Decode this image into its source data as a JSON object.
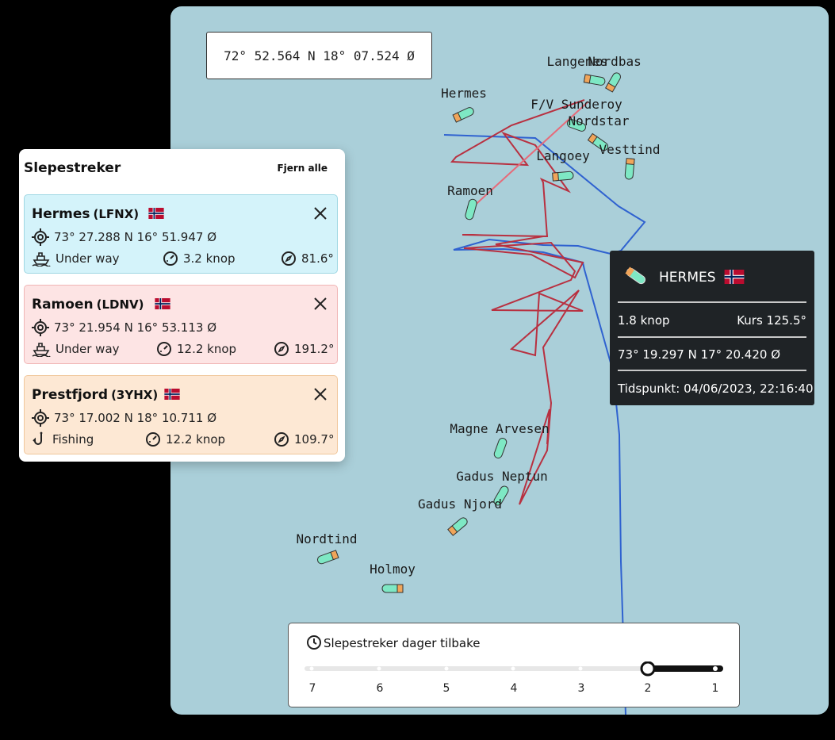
{
  "map": {
    "cursor_coordinates": "72° 52.564 N 18° 07.524 Ø",
    "vessel_labels": {
      "langenes": "Langenes",
      "nordbas": "Nordbas",
      "hermes": "Hermes",
      "fv_sunderoy": "F/V Sunderoy",
      "nordstar": "Nordstar",
      "vesttind": "Vesttind",
      "langoey": "Langoey",
      "ramoen": "Ramoen",
      "magne_arvesen": "Magne Arvesen",
      "gadus_neptun": "Gadus Neptun",
      "gadus_njord": "Gadus Njord",
      "nordtind": "Nordtind",
      "holmoy": "Holmoy"
    },
    "colors": {
      "water": "#aacfd9",
      "vessel_body": "#7ee8c4",
      "vessel_stern": "#f0a55a",
      "track_red": "#b83040",
      "track_blue": "#2f62d0"
    }
  },
  "panel": {
    "title": "Slepestreker",
    "clear_all": "Fjern alle",
    "cards": [
      {
        "name": "Hermes",
        "callsign": "(LFNX)",
        "position": "73° 27.288 N 16° 51.947 Ø",
        "status": "Under way",
        "speed": "3.2 knop",
        "course": "81.6°",
        "color": "#d4f3fa"
      },
      {
        "name": "Ramoen",
        "callsign": "(LDNV)",
        "position": "73° 21.954 N 16° 53.113 Ø",
        "status": "Under way",
        "speed": "12.2 knop",
        "course": "191.2°",
        "color": "#fde4e4"
      },
      {
        "name": "Prestfjord",
        "callsign": "(3YHX)",
        "position": "73° 17.002 N 18° 10.711 Ø",
        "status": "Fishing",
        "speed": "12.2 knop",
        "course": "109.7°",
        "color": "#fde8d4"
      }
    ]
  },
  "tooltip": {
    "vessel": "HERMES",
    "speed": "1.8 knop",
    "course": "Kurs 125.5°",
    "position": "73° 19.297 N 17° 20.420 Ø",
    "timestamp": "Tidspunkt: 04/06/2023, 22:16:40"
  },
  "timeline": {
    "title": "Slepestreker dager tilbake",
    "ticks": [
      "7",
      "6",
      "5",
      "4",
      "3",
      "2",
      "1"
    ],
    "selected": "2"
  }
}
